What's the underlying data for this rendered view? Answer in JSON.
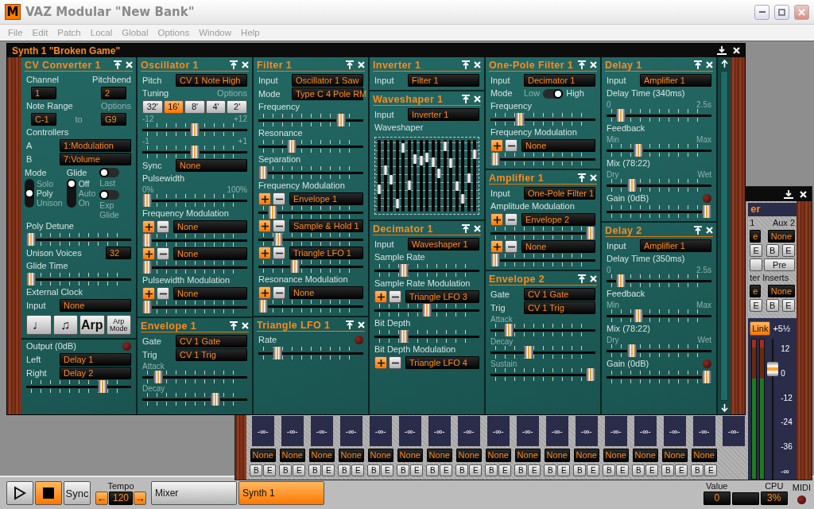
{
  "window": {
    "logo": "M",
    "title": "VAZ Modular \"New Bank\""
  },
  "menu": [
    "File",
    "Edit",
    "Patch",
    "Local",
    "Global",
    "Options",
    "Window",
    "Help"
  ],
  "synth": {
    "title": "Synth 1 \"Broken Game\"",
    "columns": [
      {
        "modules": [
          {
            "title": "CV Converter 1",
            "rows": [
              {
                "kind": "labels",
                "items": [
                  {
                    "text": "Channel",
                    "dim": false
                  },
                  {
                    "text": "Pitchbend",
                    "dim": false
                  }
                ]
              },
              {
                "kind": "boxes",
                "items": [
                  {
                    "kind": "value",
                    "text": "1"
                  },
                  {
                    "kind": "value",
                    "text": "2"
                  }
                ]
              },
              {
                "kind": "labels",
                "items": [
                  {
                    "text": "Note Range",
                    "dim": false
                  },
                  {
                    "text": "Options",
                    "dim": true
                  }
                ]
              },
              {
                "kind": "boxes",
                "items": [
                  {
                    "kind": "value",
                    "text": "C-1"
                  },
                  {
                    "kind": "text",
                    "text": "to"
                  },
                  {
                    "kind": "value",
                    "text": "G9"
                  }
                ]
              },
              {
                "kind": "label",
                "text": "Controllers"
              },
              {
                "kind": "field",
                "label": "A",
                "value": "1:Modulation"
              },
              {
                "kind": "field",
                "label": "B",
                "value": "7:Volume"
              },
              {
                "kind": "selectors",
                "groups": [
                  {
                    "label": "Mode",
                    "options": [
                      {
                        "label": "Solo",
                        "selected": false
                      },
                      {
                        "label": "Poly",
                        "selected": true
                      },
                      {
                        "label": "Unison",
                        "selected": false
                      }
                    ]
                  },
                  {
                    "label": "Glide",
                    "options": [
                      {
                        "label": "Off",
                        "selected": true
                      },
                      {
                        "label": "Auto",
                        "selected": false
                      },
                      {
                        "label": "On",
                        "selected": false
                      }
                    ]
                  }
                ],
                "toggles": [
                  {
                    "label": "Last",
                    "on": false
                  },
                  {
                    "label": "Exp Glide",
                    "on": false
                  }
                ]
              },
              {
                "kind": "label",
                "text": "Poly Detune"
              },
              {
                "kind": "slider",
                "level": 0
              },
              {
                "kind": "number",
                "label": "Unison Voices",
                "value": "32"
              },
              {
                "kind": "label",
                "text": "Glide Time"
              },
              {
                "kind": "slider",
                "level": 0
              },
              {
                "kind": "label",
                "text": "External Clock"
              },
              {
                "kind": "field",
                "label": "Input",
                "value": "None"
              },
              {
                "kind": "keys",
                "items": [
                  "♩",
                  "♫",
                  "Arp",
                  "Arp Mode"
                ]
              }
            ]
          },
          {
            "rows": [
              {
                "kind": "ledlabel",
                "text": "Output (0dB)",
                "lit": false
              },
              {
                "kind": "field",
                "label": "Left",
                "value": "Delay 1"
              },
              {
                "kind": "field",
                "label": "Right",
                "value": "Delay 2"
              },
              {
                "kind": "slider",
                "level": 0.75
              }
            ]
          }
        ]
      },
      {
        "modules": [
          {
            "title": "Oscillator 1",
            "rows": [
              {
                "kind": "field",
                "label": "Pitch",
                "value": "CV 1 Note High"
              },
              {
                "kind": "labels",
                "items": [
                  {
                    "text": "Tuning",
                    "dim": false
                  },
                  {
                    "text": "Options",
                    "dim": true
                  }
                ]
              },
              {
                "kind": "tuning",
                "options": [
                  {
                    "label": "32'",
                    "selected": false
                  },
                  {
                    "label": "16'",
                    "selected": true
                  },
                  {
                    "label": "8'",
                    "selected": false
                  },
                  {
                    "label": "4'",
                    "selected": false
                  },
                  {
                    "label": "2'",
                    "selected": false
                  }
                ]
              },
              {
                "kind": "slider",
                "level": 0.5,
                "scale": [
                  "-12",
                  "+12"
                ]
              },
              {
                "kind": "slider",
                "level": 0.5,
                "scale": [
                  "-1",
                  "+1"
                ]
              },
              {
                "kind": "field",
                "label": "Sync",
                "value": "None"
              },
              {
                "kind": "label",
                "text": "Pulsewidth"
              },
              {
                "kind": "slider",
                "level": 0,
                "scale": [
                  "0%",
                  "100%"
                ]
              },
              {
                "kind": "label",
                "text": "Frequency Modulation"
              },
              {
                "kind": "mod",
                "value": "None"
              },
              {
                "kind": "slider",
                "level": 0
              },
              {
                "kind": "mod",
                "value": "None"
              },
              {
                "kind": "slider",
                "level": 0
              },
              {
                "kind": "label",
                "text": "Pulsewidth Modulation"
              },
              {
                "kind": "mod",
                "value": "None"
              },
              {
                "kind": "slider",
                "level": 0
              }
            ]
          },
          {
            "title": "Envelope 1",
            "rows": [
              {
                "kind": "field",
                "label": "Gate",
                "value": "CV 1 Gate"
              },
              {
                "kind": "field",
                "label": "Trig",
                "value": "CV 1 Trig"
              },
              {
                "kind": "slider",
                "level": 0.12,
                "scale": [
                  "Attack"
                ]
              },
              {
                "kind": "slider",
                "level": 0.72,
                "scale": [
                  "Decay"
                ]
              }
            ]
          }
        ]
      },
      {
        "modules": [
          {
            "title": "Filter 1",
            "rows": [
              {
                "kind": "field",
                "label": "Input",
                "value": "Oscillator 1 Saw"
              },
              {
                "kind": "field",
                "label": "Mode",
                "value": "Type C 4 Pole RM"
              },
              {
                "kind": "label",
                "text": "Frequency"
              },
              {
                "kind": "slider",
                "level": 0.82
              },
              {
                "kind": "label",
                "text": "Resonance"
              },
              {
                "kind": "slider",
                "level": 0.3
              },
              {
                "kind": "label",
                "text": "Separation"
              },
              {
                "kind": "slider",
                "level": 0
              },
              {
                "kind": "label",
                "text": "Frequency Modulation"
              },
              {
                "kind": "mod",
                "value": "Envelope 1"
              },
              {
                "kind": "slider",
                "level": 0.1
              },
              {
                "kind": "mod",
                "value": "Sample & Hold 1"
              },
              {
                "kind": "slider",
                "level": 0.16
              },
              {
                "kind": "mod",
                "value": "Triangle LFO 1"
              },
              {
                "kind": "slider",
                "level": 0.33
              },
              {
                "kind": "label",
                "text": "Resonance Modulation"
              },
              {
                "kind": "mod",
                "value": "None"
              },
              {
                "kind": "slider",
                "level": 0
              }
            ]
          },
          {
            "title": "Triangle LFO 1",
            "rows": [
              {
                "kind": "ledlabel",
                "text": "Rate",
                "lit": false
              },
              {
                "kind": "slider",
                "level": 0.15
              }
            ]
          }
        ]
      },
      {
        "modules": [
          {
            "title": "Inverter 1",
            "rows": [
              {
                "kind": "field",
                "label": "Input",
                "value": "Filter 1"
              }
            ]
          },
          {
            "title": "Waveshaper 1",
            "rows": [
              {
                "kind": "field",
                "label": "Input",
                "value": "Inverter 1"
              },
              {
                "kind": "label",
                "text": "Waveshaper"
              },
              {
                "kind": "waveshaper",
                "bands": [
                  {
                    "level": 0.28
                  },
                  {
                    "level": 0.59
                  },
                  {
                    "level": 0.43
                  },
                  {
                    "level": 0.05
                  },
                  {
                    "level": 0.95
                  },
                  {
                    "level": 0.34
                  },
                  {
                    "level": 0.77
                  },
                  {
                    "level": 0.75
                  },
                  {
                    "level": 0.8
                  },
                  {
                    "level": 0.72
                  },
                  {
                    "level": 0.54
                  },
                  {
                    "level": 0.98
                  },
                  {
                    "level": 0.7
                  },
                  {
                    "level": 0.33
                  },
                  {
                    "level": 0.13
                  },
                  {
                    "level": 0.46
                  },
                  {
                    "level": 0.84
                  }
                ]
              }
            ]
          },
          {
            "title": "Decimator 1",
            "rows": [
              {
                "kind": "field",
                "label": "Input",
                "value": "Waveshaper 1"
              },
              {
                "kind": "label",
                "text": "Sample Rate"
              },
              {
                "kind": "slider",
                "level": 0.26
              },
              {
                "kind": "label",
                "text": "Sample Rate Modulation"
              },
              {
                "kind": "mod",
                "value": "Triangle LFO 3"
              },
              {
                "kind": "slider",
                "level": 0.5
              },
              {
                "kind": "label",
                "text": "Bit Depth"
              },
              {
                "kind": "slider",
                "level": 0.26
              },
              {
                "kind": "label",
                "text": "Bit Depth Modulation"
              },
              {
                "kind": "mod",
                "value": "Triangle LFO 4"
              }
            ]
          }
        ]
      },
      {
        "modules": [
          {
            "title": "One-Pole Filter 1",
            "rows": [
              {
                "kind": "field",
                "label": "Input",
                "value": "Decimator 1"
              },
              {
                "kind": "switch",
                "label": "Mode",
                "off_label": "Low",
                "on_label": "High",
                "on": true
              },
              {
                "kind": "label",
                "text": "Frequency"
              },
              {
                "kind": "slider",
                "level": 0.26
              },
              {
                "kind": "label",
                "text": "Frequency Modulation"
              },
              {
                "kind": "mod",
                "value": "None"
              },
              {
                "kind": "slider",
                "level": 0
              }
            ]
          },
          {
            "title": "Amplifier 1",
            "rows": [
              {
                "kind": "field",
                "label": "Input",
                "value": "One-Pole Filter 1"
              },
              {
                "kind": "label",
                "text": "Amplitude Modulation"
              },
              {
                "kind": "mod",
                "value": "Envelope 2"
              },
              {
                "kind": "slider",
                "level": 1
              },
              {
                "kind": "mod",
                "value": "None"
              },
              {
                "kind": "slider",
                "level": 0
              }
            ]
          },
          {
            "title": "Envelope 2",
            "rows": [
              {
                "kind": "field",
                "label": "Gate",
                "value": "CV 1 Gate"
              },
              {
                "kind": "field",
                "label": "Trig",
                "value": "CV 1 Trig"
              },
              {
                "kind": "slider",
                "level": 0.14,
                "scale": [
                  "Attack"
                ]
              },
              {
                "kind": "slider",
                "level": 0.35,
                "scale": [
                  "Decay"
                ]
              },
              {
                "kind": "slider",
                "level": 1,
                "scale": [
                  "Sustain"
                ]
              }
            ]
          }
        ]
      },
      {
        "modules": [
          {
            "title": "Delay 1",
            "rows": [
              {
                "kind": "field",
                "label": "Input",
                "value": "Amplifier 1"
              },
              {
                "kind": "label",
                "text": "Delay Time (340ms)"
              },
              {
                "kind": "slider",
                "level": 0.1,
                "scale": [
                  "0",
                  "2.5s"
                ]
              },
              {
                "kind": "label",
                "text": "Feedback"
              },
              {
                "kind": "slider",
                "level": 0.28,
                "scale": [
                  "Min",
                  "Max"
                ]
              },
              {
                "kind": "label",
                "text": "Mix (78:22)"
              },
              {
                "kind": "slider",
                "level": 0.22,
                "scale": [
                  "Dry",
                  "Wet"
                ]
              },
              {
                "kind": "ledlabel",
                "text": "Gain (0dB)",
                "lit": false
              },
              {
                "kind": "slider",
                "level": 1
              }
            ]
          },
          {
            "title": "Delay 2",
            "rows": [
              {
                "kind": "field",
                "label": "Input",
                "value": "Amplifier 1"
              },
              {
                "kind": "label",
                "text": "Delay Time (350ms)"
              },
              {
                "kind": "slider",
                "level": 0.1,
                "scale": [
                  "0",
                  "2.5s"
                ]
              },
              {
                "kind": "label",
                "text": "Feedback"
              },
              {
                "kind": "slider",
                "level": 0.28,
                "scale": [
                  "Min",
                  "Max"
                ]
              },
              {
                "kind": "label",
                "text": "Mix (78:22)"
              },
              {
                "kind": "slider",
                "level": 0.22,
                "scale": [
                  "Dry",
                  "Wet"
                ]
              },
              {
                "kind": "ledlabel",
                "text": "Gain (0dB)",
                "lit": false
              },
              {
                "kind": "slider",
                "level": 1
              }
            ]
          }
        ]
      }
    ]
  },
  "mixer": {
    "title": "er",
    "aux_labels": [
      "1",
      "Aux 2"
    ],
    "aux_sends": [
      "e",
      "None"
    ],
    "aux_buttons": [
      "E",
      "B",
      "E"
    ],
    "pre": "Pre",
    "inserts_label": "ter Inserts",
    "inserts": [
      "e",
      "None"
    ],
    "insert_buttons": [
      "E",
      "B",
      "E"
    ],
    "link": {
      "label": "Link",
      "on": true
    },
    "gain": "+5½",
    "fader": {
      "level": 0.82
    },
    "scale": [
      "12",
      "0",
      "-12",
      "-24",
      "-36",
      "-∞"
    ],
    "channels": [
      {
        "fader": "-∞-",
        "insert": "None",
        "buttons": [
          "B",
          "E"
        ]
      },
      {
        "fader": "-∞-",
        "insert": "None",
        "buttons": [
          "B",
          "E"
        ]
      },
      {
        "fader": "-∞-",
        "insert": "None",
        "buttons": [
          "B",
          "E"
        ]
      },
      {
        "fader": "-∞-",
        "insert": "None",
        "buttons": [
          "B",
          "E"
        ]
      },
      {
        "fader": "-∞-",
        "insert": "None",
        "buttons": [
          "B",
          "E"
        ]
      },
      {
        "fader": "-∞-",
        "insert": "None",
        "buttons": [
          "B",
          "E"
        ]
      },
      {
        "fader": "-∞-",
        "insert": "None",
        "buttons": [
          "B",
          "E"
        ]
      },
      {
        "fader": "-∞-",
        "insert": "None",
        "buttons": [
          "B",
          "E"
        ]
      },
      {
        "fader": "-∞-",
        "insert": "None",
        "buttons": [
          "B",
          "E"
        ]
      },
      {
        "fader": "-∞-",
        "insert": "None",
        "buttons": [
          "B",
          "E"
        ]
      },
      {
        "fader": "-∞-",
        "insert": "None",
        "buttons": [
          "B",
          "E"
        ]
      },
      {
        "fader": "-∞-",
        "insert": "None",
        "buttons": [
          "B",
          "E"
        ]
      },
      {
        "fader": "-∞-",
        "insert": "None",
        "buttons": [
          "B",
          "E"
        ]
      },
      {
        "fader": "-∞-",
        "insert": "None",
        "buttons": [
          "B",
          "E"
        ]
      },
      {
        "fader": "-∞-",
        "insert": "None",
        "buttons": [
          "B",
          "E"
        ]
      },
      {
        "fader": "-∞-",
        "insert": "None",
        "buttons": [
          "B",
          "E"
        ]
      }
    ],
    "extra_fader": "-∞-"
  },
  "transport": {
    "controls": [
      {
        "kind": "play",
        "selected": false
      },
      {
        "kind": "stop",
        "selected": true
      },
      {
        "kind": "sync",
        "label": "Sync",
        "selected": false
      }
    ],
    "tempo": {
      "label": "Tempo",
      "down": "←",
      "value": "120",
      "up": "→"
    },
    "tabs": [
      {
        "label": "Mixer",
        "selected": false
      },
      {
        "label": "Synth 1",
        "selected": true
      }
    ]
  },
  "status": {
    "value_label": "Value",
    "value": "0",
    "cpu_label": "CPU",
    "cpu": "3%",
    "midi_label": "MIDI",
    "midi_lit": false
  }
}
